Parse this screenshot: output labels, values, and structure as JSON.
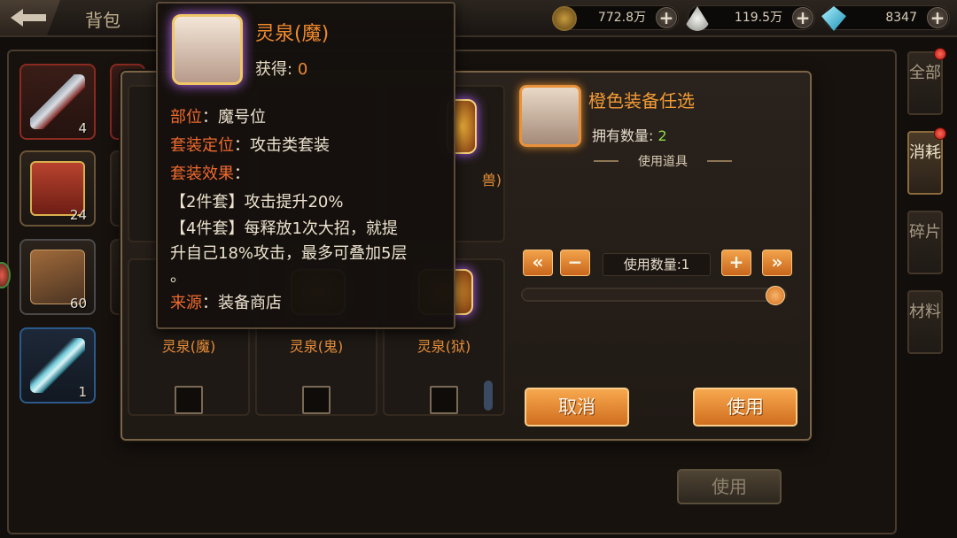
{
  "header": {
    "title": "背包",
    "gold": "772.8万",
    "food": "119.5万",
    "gems": "8347"
  },
  "tabs": [
    "全部",
    "消耗",
    "碎片",
    "材料"
  ],
  "bag_slots": [
    {
      "count": "4",
      "icon": "kunai-icon"
    },
    {
      "count": "24",
      "icon": "treasure-chest-icon"
    },
    {
      "count": "60",
      "icon": "scroll-bundle-icon"
    },
    {
      "count": "1",
      "icon": "crystal-sword-icon"
    }
  ],
  "bottom_use_label": "使用",
  "dialog": {
    "choices": [
      {
        "label": "灵泉(魔)"
      },
      {
        "label": "灵泉(鬼)"
      },
      {
        "label": "灵泉(狱)"
      }
    ],
    "top_right_label": "兽)",
    "item_title": "橙色装备任选",
    "owned_label": "拥有数量:",
    "owned_value": "2",
    "use_item_label": "使用道具",
    "qty_label": "使用数量:1",
    "quantity": 1,
    "quantity_max": 2,
    "cancel_label": "取消",
    "use_label": "使用"
  },
  "tooltip": {
    "name": "灵泉(魔)",
    "obtained_label": "获得:",
    "obtained_value": "0",
    "slot_key": "部位",
    "slot_value": "：魔号位",
    "set_pos_key": "套装定位",
    "set_pos_value": "：攻击类套装",
    "set_eff_key": "套装效果",
    "set_eff_value": "：",
    "bonus2": "【2件套】攻击提升20%",
    "bonus4_line1": "【4件套】每释放1次大招，就提",
    "bonus4_line2": "升自己18%攻击，最多可叠加5层",
    "bonus4_line3": "。",
    "source_key": "来源",
    "source_value": "：装备商店"
  },
  "colors": {
    "accent_orange": "#f08a2e",
    "owned_green": "#8fd94a",
    "key_red": "#ef6a2e"
  }
}
